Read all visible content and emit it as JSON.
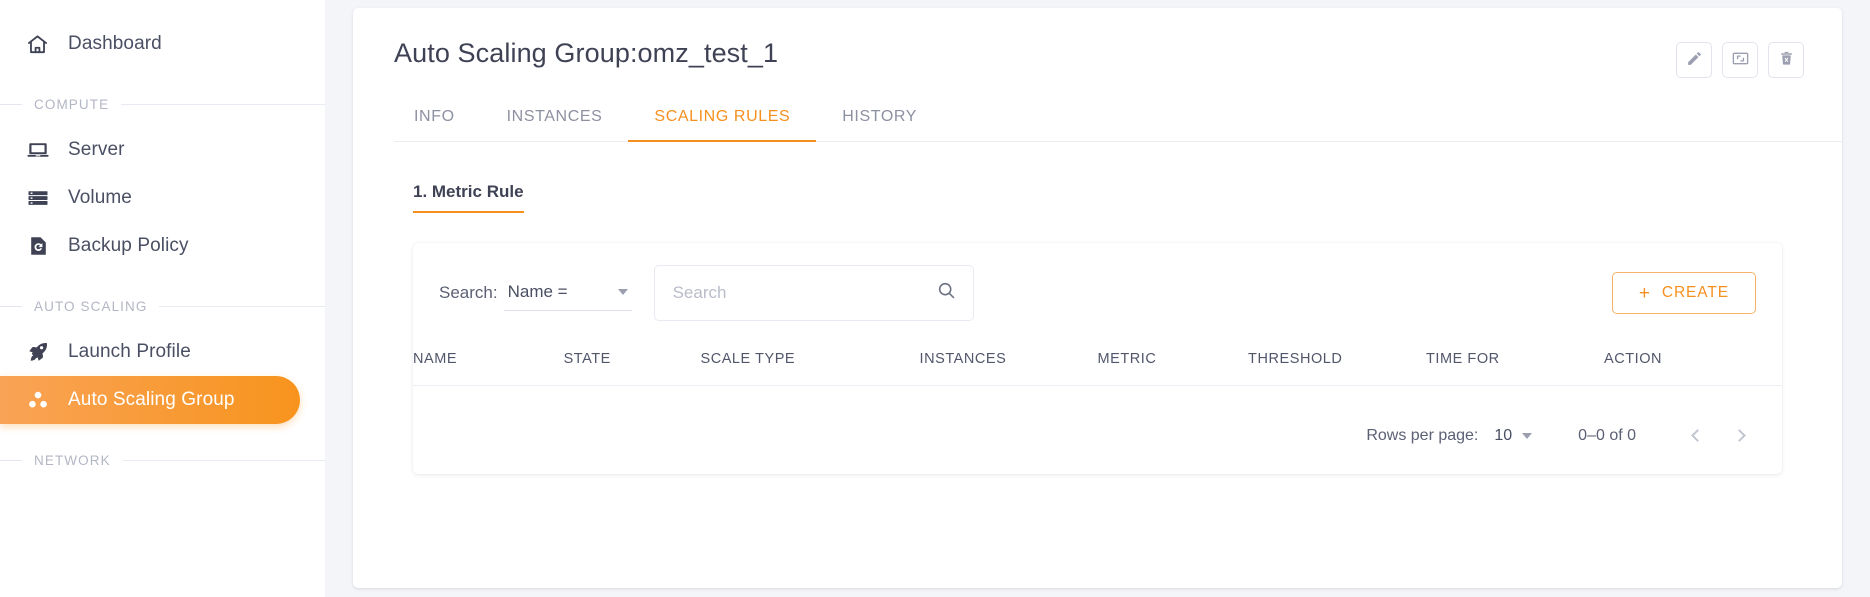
{
  "sidebar": {
    "top_items": [
      {
        "label": "Dashboard",
        "icon": "home-icon"
      }
    ],
    "sections": [
      {
        "title": "COMPUTE",
        "items": [
          {
            "label": "Server",
            "icon": "laptop-icon",
            "active": false
          },
          {
            "label": "Volume",
            "icon": "server-stack-icon",
            "active": false
          },
          {
            "label": "Backup Policy",
            "icon": "backup-restore-icon",
            "active": false
          }
        ]
      },
      {
        "title": "AUTO SCALING",
        "items": [
          {
            "label": "Launch Profile",
            "icon": "rocket-icon",
            "active": false
          },
          {
            "label": "Auto Scaling Group",
            "icon": "three-dots-group-icon",
            "active": true
          }
        ]
      },
      {
        "title": "NETWORK",
        "items": []
      }
    ]
  },
  "header": {
    "title": "Auto Scaling Group:omz_test_1",
    "actions": [
      {
        "name": "edit-button",
        "icon": "pencil-icon"
      },
      {
        "name": "resize-button",
        "icon": "resize-icon"
      },
      {
        "name": "delete-button",
        "icon": "trash-icon"
      }
    ]
  },
  "tabs": [
    {
      "label": "INFO",
      "active": false
    },
    {
      "label": "INSTANCES",
      "active": false
    },
    {
      "label": "SCALING RULES",
      "active": true
    },
    {
      "label": "HISTORY",
      "active": false
    }
  ],
  "subsection": {
    "title": "1. Metric Rule"
  },
  "toolbar": {
    "search_label": "Search:",
    "filter_value": "Name =",
    "search_value": "",
    "search_placeholder": "Search",
    "search_icon": "magnifier-icon",
    "create_label": "CREATE",
    "create_plus": "+"
  },
  "table": {
    "columns": [
      "NAME",
      "STATE",
      "SCALE TYPE",
      "INSTANCES",
      "METRIC",
      "THRESHOLD",
      "TIME FOR",
      "ACTION"
    ],
    "rows": []
  },
  "pagination": {
    "rows_per_page_label": "Rows per page:",
    "rows_per_page_value": "10",
    "range_label": "0–0 of 0",
    "prev_icon": "chevron-left-icon",
    "next_icon": "chevron-right-icon"
  },
  "colors": {
    "accent": "#f5901f",
    "accent_light": "#f9a356",
    "text": "#4a4f63",
    "muted": "#b3b6c4",
    "page_bg": "#f4f5f9"
  }
}
